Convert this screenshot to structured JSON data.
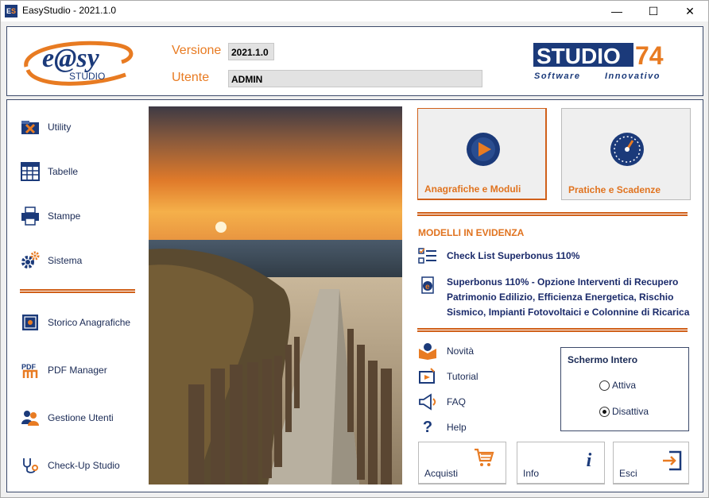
{
  "window": {
    "title": "EasyStudio - 2021.1.0",
    "controls": {
      "minimize": "—",
      "maximize": "☐",
      "close": "✕"
    }
  },
  "header": {
    "logo_text": "e@sy",
    "logo_subtext": "STUDIO",
    "version_label": "Versione",
    "version_value": "2021.1.0",
    "user_label": "Utente",
    "user_value": "ADMIN",
    "brand_name": "STUDIO",
    "brand_number": "74",
    "brand_tagline_1": "Software",
    "brand_tagline_2": "Innovativo"
  },
  "sidebar": {
    "items_top": [
      {
        "label": "Utility",
        "icon": "toolbox-icon"
      },
      {
        "label": "Tabelle",
        "icon": "table-icon"
      },
      {
        "label": "Stampe",
        "icon": "printer-icon"
      },
      {
        "label": "Sistema",
        "icon": "gears-icon"
      }
    ],
    "items_bottom": [
      {
        "label": "Storico Anagrafiche",
        "icon": "safe-icon"
      },
      {
        "label": "PDF Manager",
        "icon": "pdf-icon"
      },
      {
        "label": "Gestione Utenti",
        "icon": "users-icon"
      },
      {
        "label": "Check-Up Studio",
        "icon": "stethoscope-icon"
      }
    ]
  },
  "main_buttons": {
    "anagrafiche": "Anagrafiche e Moduli",
    "pratiche": "Pratiche e Scadenze"
  },
  "modelli": {
    "title": "MODELLI IN EVIDENZA",
    "items": [
      {
        "text": "Check List Superbonus 110%",
        "icon": "checklist-icon"
      },
      {
        "text_line1": "Superbonus 110% - Opzione Interventi di Recupero",
        "text_line2": "Patrimonio Edilizio, Efficienza Energetica, Rischio",
        "text_line3": "Sismico, Impianti Fotovoltaici e Colonnine di Ricarica",
        "icon": "ie-document-icon"
      }
    ]
  },
  "links": [
    {
      "label": "Novità",
      "icon": "book-icon"
    },
    {
      "label": "Tutorial",
      "icon": "tutorial-icon"
    },
    {
      "label": "FAQ",
      "icon": "megaphone-icon"
    },
    {
      "label": "Help",
      "icon": "question-icon"
    }
  ],
  "fullscreen": {
    "title": "Schermo Intero",
    "option_on": "Attiva",
    "option_off": "Disattiva",
    "selected": "Disattiva"
  },
  "bottom_buttons": {
    "acquisti": "Acquisti",
    "info": "Info",
    "esci": "Esci"
  },
  "colors": {
    "accent": "#e0731f",
    "navy": "#1a2a55",
    "brand_blue": "#1b3a7a"
  }
}
